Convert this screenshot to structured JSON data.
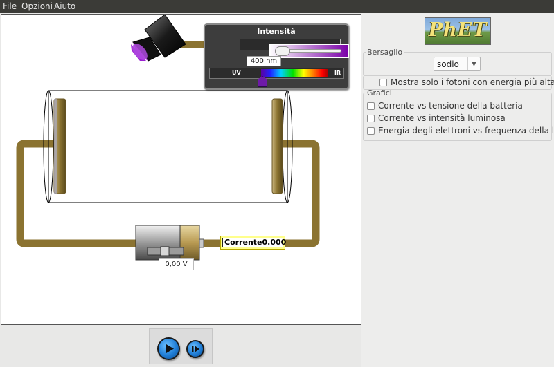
{
  "menu": {
    "file": "File",
    "options": "Opzioni",
    "help": "Aiuto"
  },
  "light_panel": {
    "title": "Intensità",
    "wavelength": "400 nm",
    "uv_label": "UV",
    "ir_label": "IR"
  },
  "battery": {
    "voltage": "0,00 V"
  },
  "ammeter": {
    "label": "Corrente",
    "value": "0.000"
  },
  "logo": {
    "text": "PhET"
  },
  "target": {
    "group_title": "Bersaglio",
    "selected": "sodio",
    "only_high_energy_photons": "Mostra solo i fotoni con energia più alta"
  },
  "graphs": {
    "group_title": "Grafici",
    "items": [
      "Corrente vs tensione della batteria",
      "Corrente vs intensità luminosa",
      "Energia degli elettroni vs frequenza della luce"
    ]
  },
  "colors": {
    "wire": "#8b7331",
    "panel": "#3c3c3c",
    "ammeter_bg": "#ffff8c",
    "light_beam": "#7a00a8"
  }
}
